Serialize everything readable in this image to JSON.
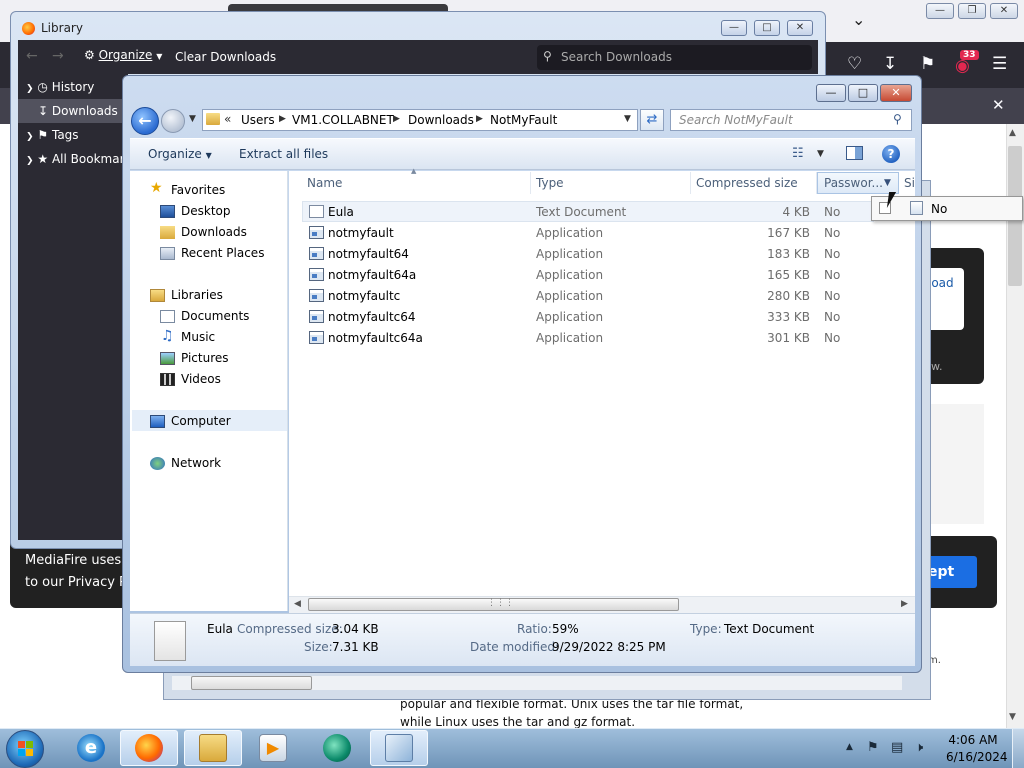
{
  "firefox": {
    "library": {
      "title": "Library",
      "organize_label": "Organize",
      "clear_downloads_label": "Clear Downloads",
      "search_placeholder": "Search Downloads",
      "sidebar": [
        {
          "label": "History"
        },
        {
          "label": "Downloads"
        },
        {
          "label": "Tags"
        },
        {
          "label": "All Bookmarks"
        }
      ]
    },
    "toolbar": {
      "badge_count": "33"
    },
    "page": {
      "download_button": "load",
      "card_text": "w.",
      "cookie_text_1": "MediaFire uses c",
      "cookie_text_2": "to our Privacy Po",
      "accept_label": "ept",
      "side_text": "m.",
      "article_line_1": "popular and flexible format. Unix uses the tar file format,",
      "article_line_2": "while Linux uses the tar and gz format."
    }
  },
  "explorer": {
    "breadcrumbs": [
      "Users",
      "VM1.COLLABNET",
      "Downloads",
      "NotMyFault"
    ],
    "search_placeholder": "Search NotMyFault",
    "commands": {
      "organize": "Organize",
      "extract_all": "Extract all files"
    },
    "nav": {
      "favorites": "Favorites",
      "desktop": "Desktop",
      "downloads": "Downloads",
      "recent_places": "Recent Places",
      "libraries": "Libraries",
      "documents": "Documents",
      "music": "Music",
      "pictures": "Pictures",
      "videos": "Videos",
      "computer": "Computer",
      "network": "Network"
    },
    "columns": {
      "name": "Name",
      "type": "Type",
      "compressed_size": "Compressed size",
      "password": "Passwor...",
      "size": "Si"
    },
    "files": [
      {
        "name": "Eula",
        "type": "Text Document",
        "compressed_size": "4 KB",
        "password": "No",
        "icon": "text-document-icon"
      },
      {
        "name": "notmyfault",
        "type": "Application",
        "compressed_size": "167 KB",
        "password": "No",
        "icon": "application-icon"
      },
      {
        "name": "notmyfault64",
        "type": "Application",
        "compressed_size": "183 KB",
        "password": "No",
        "icon": "application-icon"
      },
      {
        "name": "notmyfault64a",
        "type": "Application",
        "compressed_size": "165 KB",
        "password": "No",
        "icon": "application-icon"
      },
      {
        "name": "notmyfaultc",
        "type": "Application",
        "compressed_size": "280 KB",
        "password": "No",
        "icon": "application-icon"
      },
      {
        "name": "notmyfaultc64",
        "type": "Application",
        "compressed_size": "333 KB",
        "password": "No",
        "icon": "application-icon"
      },
      {
        "name": "notmyfaultc64a",
        "type": "Application",
        "compressed_size": "301 KB",
        "password": "No",
        "icon": "application-icon"
      }
    ],
    "password_filter": {
      "option": "No"
    },
    "details": {
      "name": "Eula",
      "compressed_size_label": "Compressed size:",
      "compressed_size": "3.04 KB",
      "size_label": "Size:",
      "size": "7.31 KB",
      "ratio_label": "Ratio:",
      "ratio": "59%",
      "date_modified_label": "Date modified:",
      "date_modified": "9/29/2022 8:25 PM",
      "type_label": "Type:",
      "type": "Text Document"
    }
  },
  "taskbar": {
    "time": "4:06 AM",
    "date": "6/16/2024",
    "apps": [
      "internet-explorer-icon",
      "firefox-icon",
      "file-explorer-icon",
      "media-player-icon",
      "browser-app-icon",
      "archive-app-icon"
    ]
  }
}
